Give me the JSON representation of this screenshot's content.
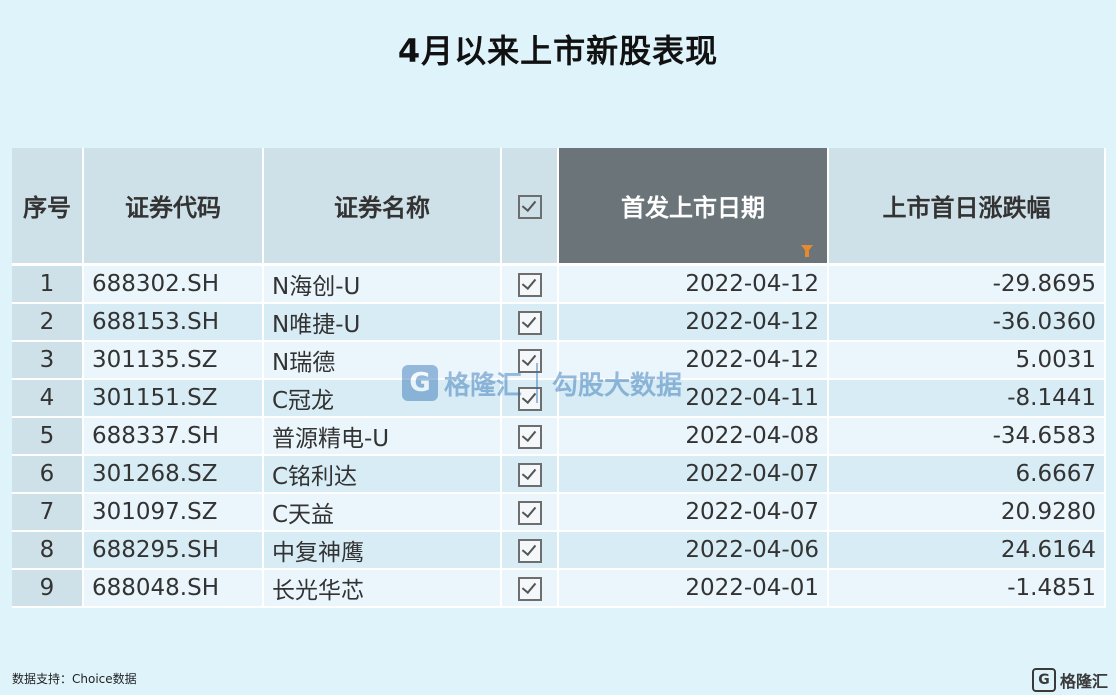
{
  "title": "4月以来上市新股表现",
  "headers": {
    "seq": "序号",
    "code": "证券代码",
    "name": "证券名称",
    "date": "首发上市日期",
    "change": "上市首日涨跌幅"
  },
  "rows": [
    {
      "seq": "1",
      "code": "688302.SH",
      "name": "N海创-U",
      "date": "2022-04-12",
      "change": "-29.8695"
    },
    {
      "seq": "2",
      "code": "688153.SH",
      "name": "N唯捷-U",
      "date": "2022-04-12",
      "change": "-36.0360"
    },
    {
      "seq": "3",
      "code": "301135.SZ",
      "name": "N瑞德",
      "date": "2022-04-12",
      "change": "5.0031"
    },
    {
      "seq": "4",
      "code": "301151.SZ",
      "name": "C冠龙",
      "date": "2022-04-11",
      "change": "-8.1441"
    },
    {
      "seq": "5",
      "code": "688337.SH",
      "name": "普源精电-U",
      "date": "2022-04-08",
      "change": "-34.6583"
    },
    {
      "seq": "6",
      "code": "301268.SZ",
      "name": "C铭利达",
      "date": "2022-04-07",
      "change": "6.6667"
    },
    {
      "seq": "7",
      "code": "301097.SZ",
      "name": "C天益",
      "date": "2022-04-07",
      "change": "20.9280"
    },
    {
      "seq": "8",
      "code": "688295.SH",
      "name": "中复神鹰",
      "date": "2022-04-06",
      "change": "24.6164"
    },
    {
      "seq": "9",
      "code": "688048.SH",
      "name": "长光华芯",
      "date": "2022-04-01",
      "change": "-1.4851"
    }
  ],
  "watermark": {
    "logo_letter": "G",
    "brand": "格隆汇",
    "brand2": "勾股大数据"
  },
  "source": "数据支持：Choice数据",
  "corner_logo": {
    "mark": "G",
    "text": "格隆汇"
  },
  "colors": {
    "background": "#dff3fb",
    "header": "#cfe1e8",
    "highlight_header": "#6b7478",
    "filter_icon": "#e58a2e"
  }
}
